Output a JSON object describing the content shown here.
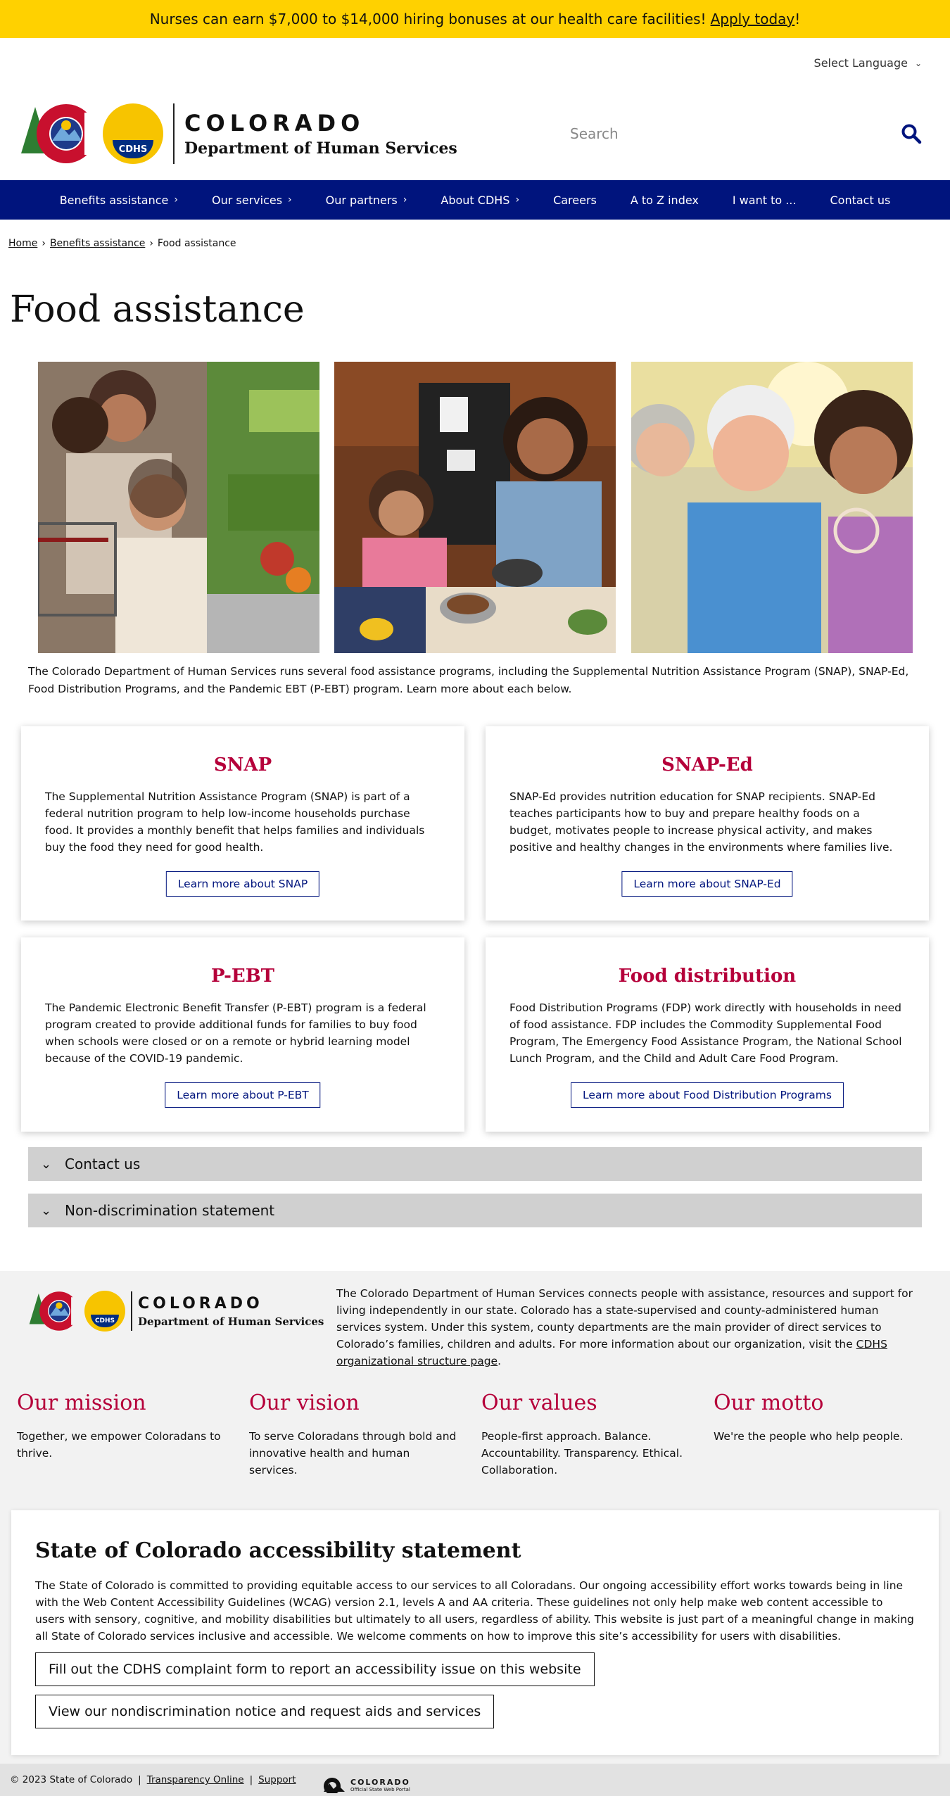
{
  "alert": {
    "text": "Nurses can earn $7,000 to $14,000 hiring bonuses at our health care facilities!",
    "link": "Apply today",
    "end": "!"
  },
  "language": {
    "label": "Select Language"
  },
  "brand": {
    "state": "COLORADO",
    "department": "Department of Human Services",
    "badge": "CDHS"
  },
  "search": {
    "placeholder": "Search"
  },
  "nav": [
    {
      "label": "Benefits assistance",
      "has_sub": true
    },
    {
      "label": "Our services",
      "has_sub": true
    },
    {
      "label": "Our partners",
      "has_sub": true
    },
    {
      "label": "About CDHS",
      "has_sub": true
    },
    {
      "label": "Careers",
      "has_sub": false
    },
    {
      "label": "A to Z index",
      "has_sub": false
    },
    {
      "label": "I want to ...",
      "has_sub": false
    },
    {
      "label": "Contact us",
      "has_sub": false
    }
  ],
  "breadcrumb": {
    "home": "Home",
    "parent": "Benefits assistance",
    "current": "Food assistance",
    "sep": "›"
  },
  "page": {
    "title": "Food assistance",
    "intro": "The Colorado Department of Human Services runs several food assistance programs, including the Supplemental Nutrition Assistance Program (SNAP), SNAP-Ed, Food Distribution Programs, and the Pandemic EBT (P-EBT) program. Learn more about each below."
  },
  "cards": [
    {
      "title": "SNAP",
      "body": "The Supplemental Nutrition Assistance Program (SNAP) is part of a federal nutrition program to help low-income households purchase food. It provides a monthly benefit that helps families and individuals buy the food they need for good health.",
      "button": "Learn more about SNAP"
    },
    {
      "title": "SNAP-Ed",
      "body": "SNAP-Ed provides nutrition education for SNAP recipients. SNAP-Ed teaches participants how to buy and prepare healthy foods on a budget, motivates people to increase physical activity, and makes positive and healthy changes in the environments where families live.",
      "button": "Learn more about SNAP-Ed"
    },
    {
      "title": "P-EBT",
      "body": "The Pandemic Electronic Benefit Transfer (P-EBT) program is a federal program created to provide additional funds for families to buy food when schools were closed or on a remote or hybrid learning model because of the COVID-19 pandemic.",
      "button": "Learn more about P-EBT"
    },
    {
      "title": "Food distribution",
      "body": "Food Distribution Programs (FDP) work directly with households in need of food assistance. FDP includes the Commodity Supplemental Food Program, The Emergency Food Assistance Program, the National School Lunch Program, and the Child and Adult Care Food Program.",
      "button": "Learn more about Food Distribution Programs"
    }
  ],
  "accordions": [
    {
      "label": "Contact us"
    },
    {
      "label": "Non-discrimination statement"
    }
  ],
  "footer": {
    "about": "The Colorado Department of Human Services connects people with assistance, resources and support for living independently in our state. Colorado has a state-supervised and county-administered human services system. Under this system, county departments are the main provider of direct services to Colorado’s families, children and adults. For more information about our organization, visit the",
    "about_link": "CDHS organizational structure page",
    "about_end": ".",
    "values": [
      {
        "title": "Our mission",
        "text": "Together, we empower Coloradans to thrive."
      },
      {
        "title": "Our vision",
        "text": "To serve Coloradans through bold and innovative health and human services."
      },
      {
        "title": "Our values",
        "text": "People-first approach. Balance. Accountability. Transparency. Ethical. Collaboration."
      },
      {
        "title": "Our motto",
        "text": "We're the people who help people."
      }
    ],
    "accessibility": {
      "title": "State of Colorado accessibility statement",
      "body": "The State of Colorado is committed to providing equitable access to our services to all Coloradans. Our ongoing accessibility effort works towards being in line with the Web Content Accessibility Guidelines (WCAG) version 2.1, levels A and AA criteria. These guidelines not only help make web content accessible to users with sensory, cognitive, and mobility disabilities but ultimately to all users, regardless of ability. This website is just part of a meaningful change in making all State of Colorado services inclusive and accessible. We welcome comments on how to improve this site’s accessibility for users with disabilities.",
      "button1": "Fill out the CDHS complaint form to report an accessibility issue on this website",
      "button2": "View our nondiscrimination notice and request aids and services"
    },
    "bottom": {
      "copyright": "© 2023 State of Colorado",
      "sep": "|",
      "link1": "Transparency Online",
      "link2": "Support",
      "portal": "COLORADO",
      "portal_sub": "Official State Web Portal"
    }
  },
  "colors": {
    "alert_bg": "#ffd100",
    "nav_bg": "#00147d",
    "accent_red": "#b5003a",
    "accordion_bg": "#d0d0d0",
    "footer_bg": "#f2f2f2"
  }
}
